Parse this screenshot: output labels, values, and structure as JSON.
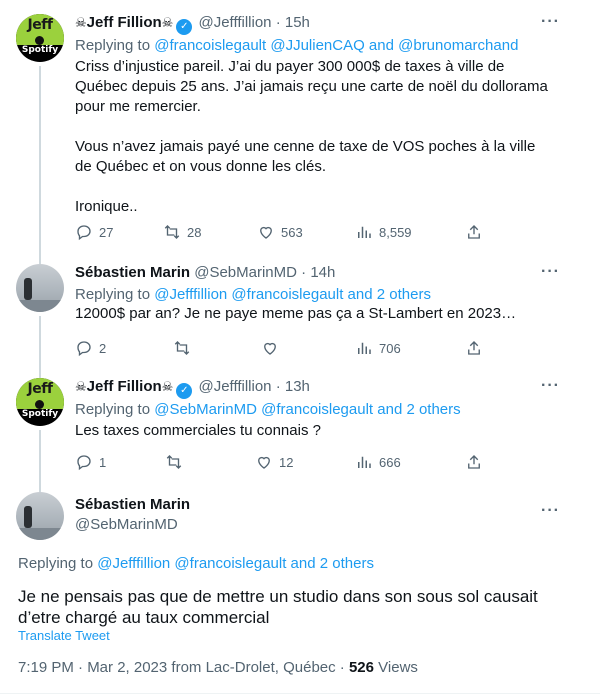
{
  "tweets": [
    {
      "name": "Jeff Fillion",
      "name_decoration": "☠",
      "handle": "@Jefffillion",
      "time": "15h",
      "avatar": {
        "line1": "Jeff",
        "line2": "Spotify"
      },
      "replying_label": "Replying to",
      "replying_to": "@francoislegault @JJulienCAQ and @brunomarchand",
      "text": "Criss d’injustice pareil. J’ai du payer 300 000$ de taxes à ville de Québec depuis 25 ans. J’ai jamais reçu une carte de noël du dollorama pour me remercier.\n\nVous n’avez jamais payé une cenne de taxe de VOS poches à la ville de Québec et on vous donne les clés.\n\nIronique..",
      "counts": {
        "replies": "27",
        "retweets": "28",
        "likes": "563",
        "views": "8,559"
      }
    },
    {
      "name": "Sébastien Marin",
      "handle": "@SebMarinMD",
      "time": "14h",
      "replying_label": "Replying to",
      "replying_to": "@Jefffillion @francoislegault and 2 others",
      "text": "12000$ par an? Je ne paye meme pas ça a St-Lambert en 2023…",
      "counts": {
        "replies": "2",
        "retweets": "",
        "likes": "",
        "views": "706"
      }
    },
    {
      "name": "Jeff Fillion",
      "name_decoration": "☠",
      "handle": "@Jefffillion",
      "time": "13h",
      "avatar": {
        "line1": "Jeff",
        "line2": "Spotify"
      },
      "replying_label": "Replying to",
      "replying_to": "@SebMarinMD @francoislegault and 2 others",
      "text": "Les taxes commerciales tu connais ?",
      "counts": {
        "replies": "1",
        "retweets": "",
        "likes": "12",
        "views": "666"
      }
    }
  ],
  "main_tweet": {
    "name": "Sébastien Marin",
    "handle": "@SebMarinMD",
    "replying_label": "Replying to",
    "replying_to": "@Jefffillion @francoislegault and 2 others",
    "text": "Je ne pensais pas que de mettre un studio dans son sous sol causait d’etre chargé au taux commercial",
    "translate_label": "Translate Tweet",
    "meta": "7:19 PM · Mar 2, 2023 from Lac-Drolet, Québec · ",
    "views_count": "526",
    "views_label": "Views"
  },
  "more_glyph": "···",
  "dot": "·",
  "colors": {
    "accent": "#1d9bf0",
    "muted": "#536471",
    "text": "#0f1419",
    "thread_line": "#cfd9de"
  },
  "icons": [
    "reply-icon",
    "retweet-icon",
    "like-icon",
    "views-icon",
    "share-icon",
    "verified-badge-icon",
    "more-icon",
    "skull-icon"
  ]
}
